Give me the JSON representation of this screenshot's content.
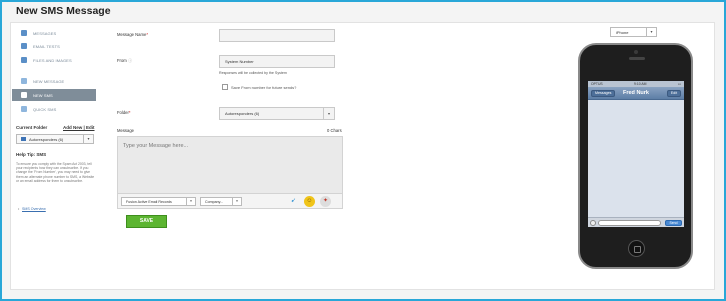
{
  "page": {
    "title": "New SMS Message"
  },
  "sidebar": {
    "items": [
      {
        "label": "MESSAGES",
        "icon": "envelope-icon"
      },
      {
        "label": "EMAIL TESTS",
        "icon": "checkbox-icon"
      },
      {
        "label": "FILES AND IMAGES",
        "icon": "file-icon"
      },
      {
        "label": "NEW MESSAGE",
        "icon": "new-message-icon"
      },
      {
        "label": "NEW SMS",
        "icon": "sms-icon"
      },
      {
        "label": "QUICK SMS",
        "icon": "quick-sms-icon"
      }
    ],
    "current_folder_label": "Current Folder",
    "folder_links": "Add New | Edit",
    "current_folder_value": "Autoresponders (6)",
    "help_title": "Help Tip: SMS",
    "help_text": "To ensure you comply with the Spam Act 2003, tell your recipients how they can unsubscribe. If you change the 'From Number', you may need to give them an alternate phone number to SMS, a Website or an email address for them to unsubscribe.",
    "help_link": "SMS Overview"
  },
  "form": {
    "message_name_label": "Message Name",
    "message_name_value": "",
    "from_label": "From",
    "from_value": "System Number",
    "from_note": "Responses will be collected by the System",
    "save_from_label": "Save From number for future sends?",
    "folder_label": "Folder",
    "folder_value": "Autoresponders (6)",
    "message_label": "Message",
    "char_count": "0 Chars",
    "message_placeholder": "Type your Message here...",
    "insert_field_value": "Fusion Active Email Records",
    "company_value": "Company...",
    "save_label": "SAVE"
  },
  "preview": {
    "device_value": "iPhone",
    "carrier": "OPTUS",
    "time": "9:10 AM",
    "back_label": "Messages",
    "contact_name": "Fred Nurk",
    "edit_label": "Edit",
    "send_label": "Send"
  },
  "colors": {
    "accent_border": "#29a7d8",
    "save_green": "#5cb531",
    "nav_active": "#7f8d99"
  }
}
